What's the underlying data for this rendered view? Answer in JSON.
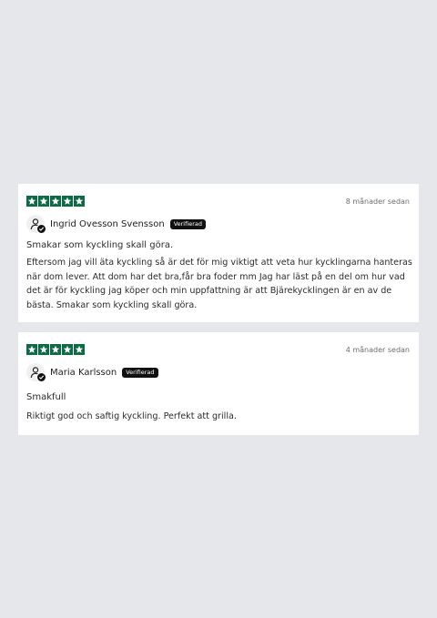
{
  "reviews": [
    {
      "rating": 5,
      "date": "8 månader sedan",
      "author": "Ingrid Ovesson Svensson",
      "badge": "Verifierad",
      "title": "Smakar som kyckling skall göra.",
      "body": "Eftersom jag vill äta kyckling så är det för mig viktigt att veta hur kycklingarna hanteras när dom lever. Att dom har det bra,får bra foder mm Jag har läst på en del om hur vad det är för kyckling jag köper och min uppfattning är att Bjärekycklingen är en av de bästa. Smakar som kyckling skall göra."
    },
    {
      "rating": 5,
      "date": "4 månader sedan",
      "author": "Maria Karlsson",
      "badge": "Verifierad",
      "title": "Smakfull",
      "body": "Riktigt god och saftig kyckling. Perfekt att grilla."
    }
  ],
  "colors": {
    "star": "#0b6b45",
    "badge_bg": "#111111",
    "page_bg": "#e6e7ea"
  },
  "icons": {
    "star": "star-icon",
    "avatar": "user-icon",
    "verified": "check-icon"
  }
}
